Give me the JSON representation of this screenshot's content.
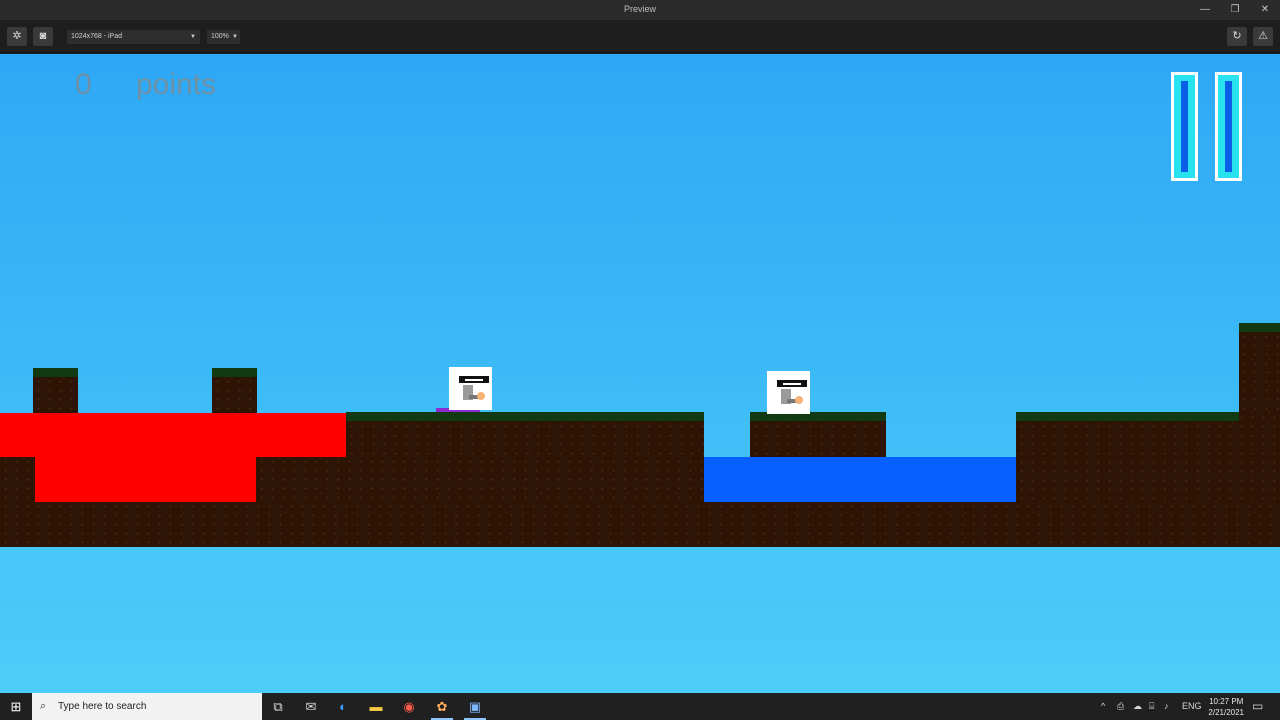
{
  "window": {
    "title": "Preview",
    "minimize_icon": "minimize-icon",
    "restore_icon": "restore-icon",
    "close_icon": "close-icon"
  },
  "toolbar": {
    "device_select": "1024x768 - iPad",
    "zoom_select": "100%"
  },
  "game": {
    "score_value": "0",
    "score_label": "points",
    "colors": {
      "sky_top": "#2ea8f6",
      "sky_bottom": "#4ccdf9",
      "lava": "#ff0000",
      "water": "#0560ff",
      "dirt": "#2d1405",
      "grass": "#123a12",
      "pause_fill": "#29e2ef"
    }
  },
  "taskbar": {
    "search_placeholder": "Type here to search",
    "language": "ENG",
    "time": "10:27 PM",
    "date": "2/21/2021"
  }
}
